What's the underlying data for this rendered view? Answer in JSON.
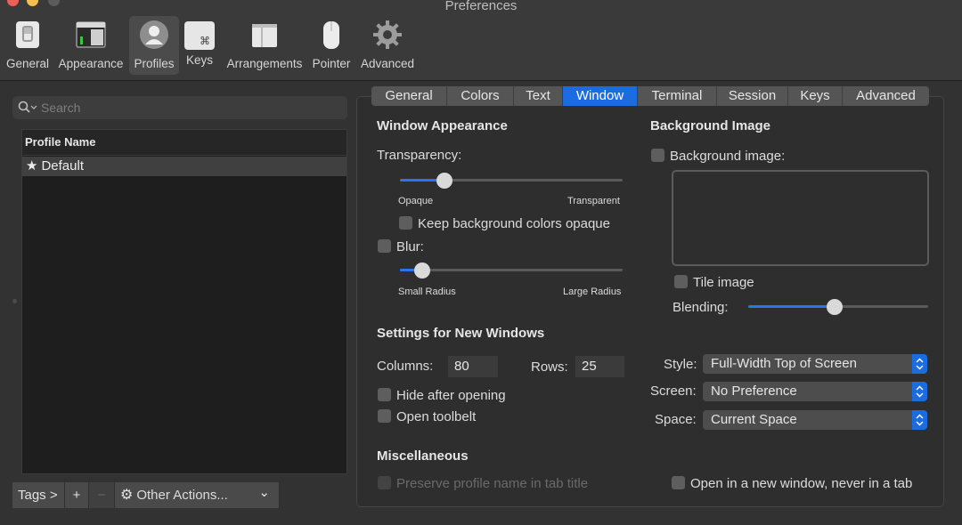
{
  "window": {
    "title": "Preferences"
  },
  "toolbar": {
    "items": [
      {
        "label": "General",
        "icon": "general-switch-icon"
      },
      {
        "label": "Appearance",
        "icon": "appearance-window-icon"
      },
      {
        "label": "Profiles",
        "icon": "profiles-person-icon",
        "active": true
      },
      {
        "label": "Keys",
        "icon": "keys-command-icon"
      },
      {
        "label": "Arrangements",
        "icon": "arrangements-windows-icon"
      },
      {
        "label": "Pointer",
        "icon": "pointer-mouse-icon"
      },
      {
        "label": "Advanced",
        "icon": "advanced-gear-icon"
      }
    ],
    "keys_glyph": "⌘"
  },
  "sidebar": {
    "search_placeholder": "Search",
    "list_header": "Profile Name",
    "profiles": [
      {
        "star": "★",
        "name": "Default"
      }
    ],
    "bottom": {
      "tags": "Tags >",
      "add": "+",
      "remove": "−",
      "other_actions": "Other Actions...",
      "gear": "⚙",
      "chevron": "⌄"
    }
  },
  "tabs": [
    {
      "label": "General"
    },
    {
      "label": "Colors"
    },
    {
      "label": "Text"
    },
    {
      "label": "Window",
      "active": true
    },
    {
      "label": "Terminal"
    },
    {
      "label": "Session"
    },
    {
      "label": "Keys"
    },
    {
      "label": "Advanced"
    }
  ],
  "window_appearance": {
    "title": "Window Appearance",
    "transparency_label": "Transparency:",
    "transparency_value": 0.2,
    "opaque": "Opaque",
    "transparent": "Transparent",
    "keep_bg_opaque": "Keep background colors opaque",
    "blur_label": "Blur:",
    "blur_value": 0.1,
    "small_radius": "Small Radius",
    "large_radius": "Large Radius"
  },
  "background_image": {
    "title": "Background Image",
    "checkbox_label": "Background image:",
    "tile_image": "Tile image",
    "blending_label": "Blending:",
    "blending_value": 0.48
  },
  "new_windows": {
    "title": "Settings for New Windows",
    "columns_label": "Columns:",
    "columns_value": "80",
    "rows_label": "Rows:",
    "rows_value": "25",
    "hide_after_opening": "Hide after opening",
    "open_toolbelt": "Open toolbelt",
    "style_label": "Style:",
    "style_value": "Full-Width Top of Screen",
    "screen_label": "Screen:",
    "screen_value": "No Preference",
    "space_label": "Space:",
    "space_value": "Current Space"
  },
  "misc": {
    "title": "Miscellaneous",
    "preserve_profile_name": "Preserve profile name in tab title",
    "open_new_window": "Open in a new window, never in a tab"
  },
  "colors": {
    "accent": "#1a6ce0",
    "panel_bg": "#2e2e2e",
    "window_bg": "#323232"
  }
}
